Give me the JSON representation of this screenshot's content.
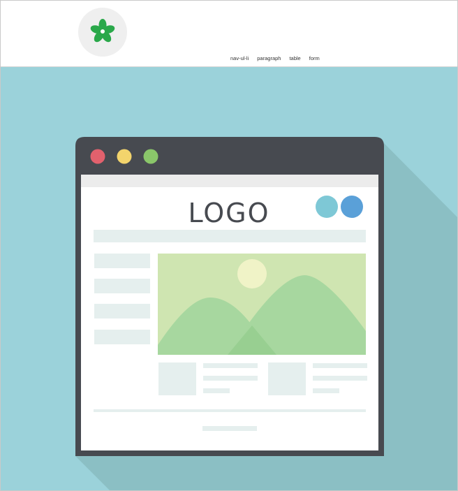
{
  "nav": {
    "items": [
      "nav-ul-li",
      "paragraph",
      "table",
      "form"
    ]
  },
  "illustration": {
    "logo_text": "LOGO"
  },
  "colors": {
    "hero_bg": "#9bd2da",
    "window_chrome": "#474a50",
    "traffic_red": "#e2616d",
    "traffic_yellow": "#f3d46c",
    "traffic_green": "#8ac66a",
    "placeholder": "#e5efee",
    "logo_green": "#2aa84a"
  }
}
